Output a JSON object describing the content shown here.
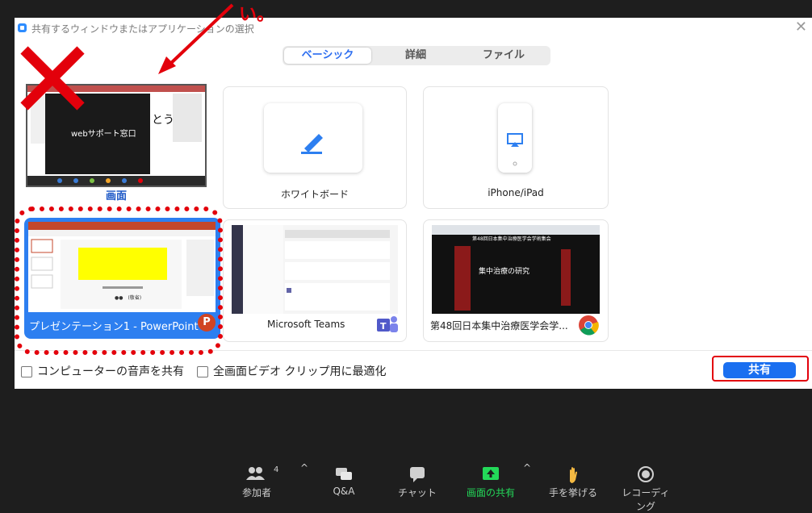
{
  "dialog": {
    "title": "共有するウィンドウまたはアプリケーションの選択",
    "tabs": [
      {
        "label": "ベーシック",
        "active": true
      },
      {
        "label": "詳細",
        "active": false
      },
      {
        "label": "ファイル",
        "active": false
      }
    ],
    "tiles": {
      "screen": {
        "label": "画面",
        "overlay_label": "webサポート窓口",
        "overlay_text": "とう"
      },
      "whiteboard": {
        "label": "ホワイトボード"
      },
      "iphone": {
        "label": "iPhone/iPad"
      },
      "powerpoint": {
        "label": "プレゼンテーション1 - PowerPoint",
        "badge": "P",
        "slide_caption": "●●　(敬省)"
      },
      "teams": {
        "label": "Microsoft Teams"
      },
      "chrome": {
        "label": "第48回日本集中治療医学会学...",
        "page_heading": "第48回日本集中治療医学会学術集会"
      }
    },
    "options": {
      "audio_label": "コンピューターの音声を共有",
      "video_label": "全画面ビデオ クリップ用に最適化"
    },
    "share_button": "共有"
  },
  "annotation": {
    "top_text": "い。"
  },
  "toolbar": [
    {
      "label": "参加者",
      "count": "4",
      "icon": "participants-icon",
      "highlight": false
    },
    {
      "label": "Q&A",
      "icon": "qa-icon",
      "highlight": false
    },
    {
      "label": "チャット",
      "icon": "chat-icon",
      "highlight": false
    },
    {
      "label": "画面の共有",
      "icon": "share-screen-icon",
      "highlight": true
    },
    {
      "label": "手を挙げる",
      "icon": "raise-hand-icon",
      "highlight": false
    },
    {
      "label": "レコーディング",
      "icon": "record-icon",
      "highlight": false
    }
  ],
  "colors": {
    "accent": "#2d7ff0",
    "annotation_red": "#e3000b",
    "share_green": "#23d959"
  }
}
